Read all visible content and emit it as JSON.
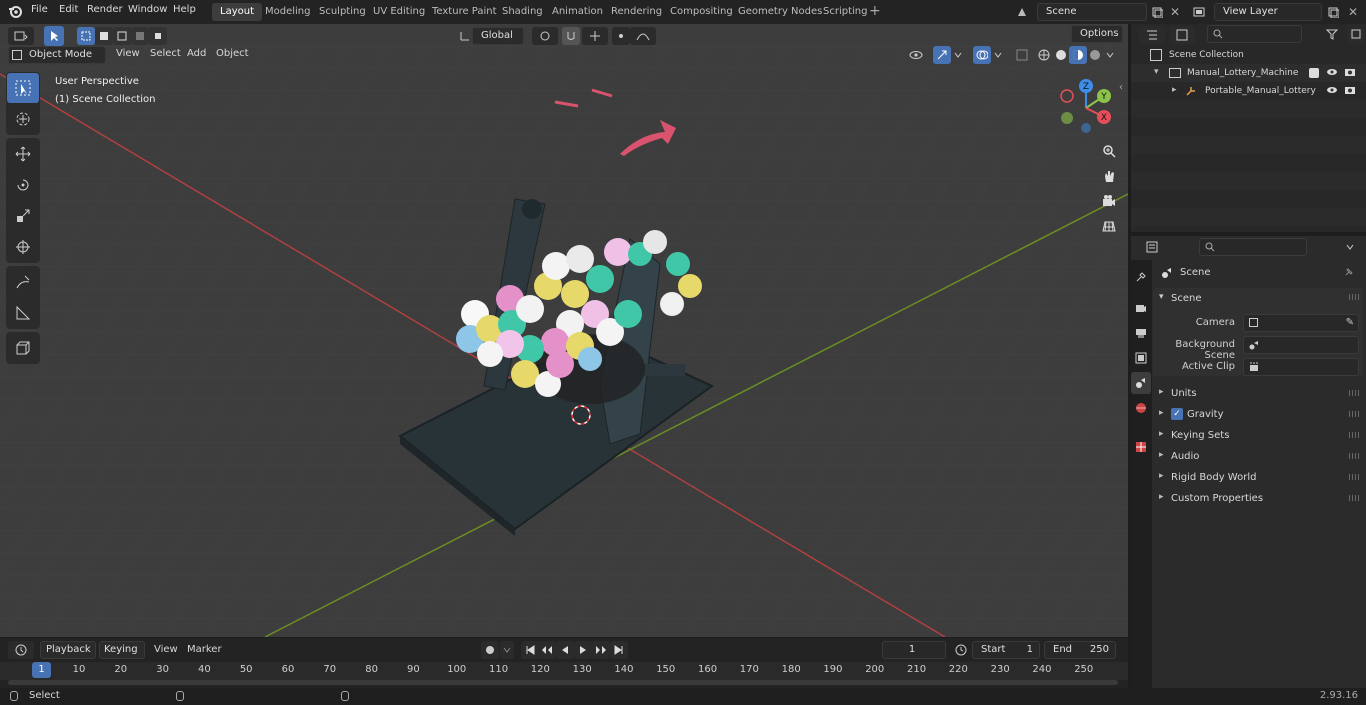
{
  "topbar": {
    "menus": [
      "File",
      "Edit",
      "Render",
      "Window",
      "Help"
    ],
    "workspaces": [
      "Layout",
      "Modeling",
      "Sculpting",
      "UV Editing",
      "Texture Paint",
      "Shading",
      "Animation",
      "Rendering",
      "Compositing",
      "Geometry Nodes",
      "Scripting"
    ],
    "active_workspace": "Layout",
    "scene_name": "Scene",
    "view_layer": "View Layer"
  },
  "viewport": {
    "mode": "Object Mode",
    "menus": [
      "View",
      "Select",
      "Add",
      "Object"
    ],
    "transform_orientation": "Global",
    "options_label": "Options",
    "overlay_text_1": "User Perspective",
    "overlay_text_2": "(1) Scene Collection",
    "gizmo_axes": [
      "Z",
      "Y",
      "X"
    ]
  },
  "timeline": {
    "menus": [
      "Playback",
      "Keying",
      "View",
      "Marker"
    ],
    "current_frame": "1",
    "start_label": "Start",
    "start_value": "1",
    "end_label": "End",
    "end_value": "250",
    "ticks": [
      "1",
      "10",
      "20",
      "30",
      "40",
      "50",
      "60",
      "70",
      "80",
      "90",
      "100",
      "110",
      "120",
      "130",
      "140",
      "150",
      "160",
      "170",
      "180",
      "190",
      "200",
      "210",
      "220",
      "230",
      "240",
      "250"
    ]
  },
  "outliner": {
    "root": "Scene Collection",
    "collection": "Manual_Lottery_Machine",
    "object": "Portable_Manual_Lottery"
  },
  "properties": {
    "context": "Scene",
    "section": "Scene",
    "camera_label": "Camera",
    "background_scene_label": "Background Scene",
    "active_clip_label": "Active Clip",
    "panels": [
      "Units",
      "Gravity",
      "Keying Sets",
      "Audio",
      "Rigid Body World",
      "Custom Properties"
    ],
    "gravity_checked": true
  },
  "status": {
    "left_label": "Select",
    "version": "2.93.16"
  },
  "colors": {
    "accent": "#4772b3",
    "x_axis": "#e54f5a",
    "y_axis": "#8bc34a",
    "z_axis": "#3d8ee8"
  }
}
